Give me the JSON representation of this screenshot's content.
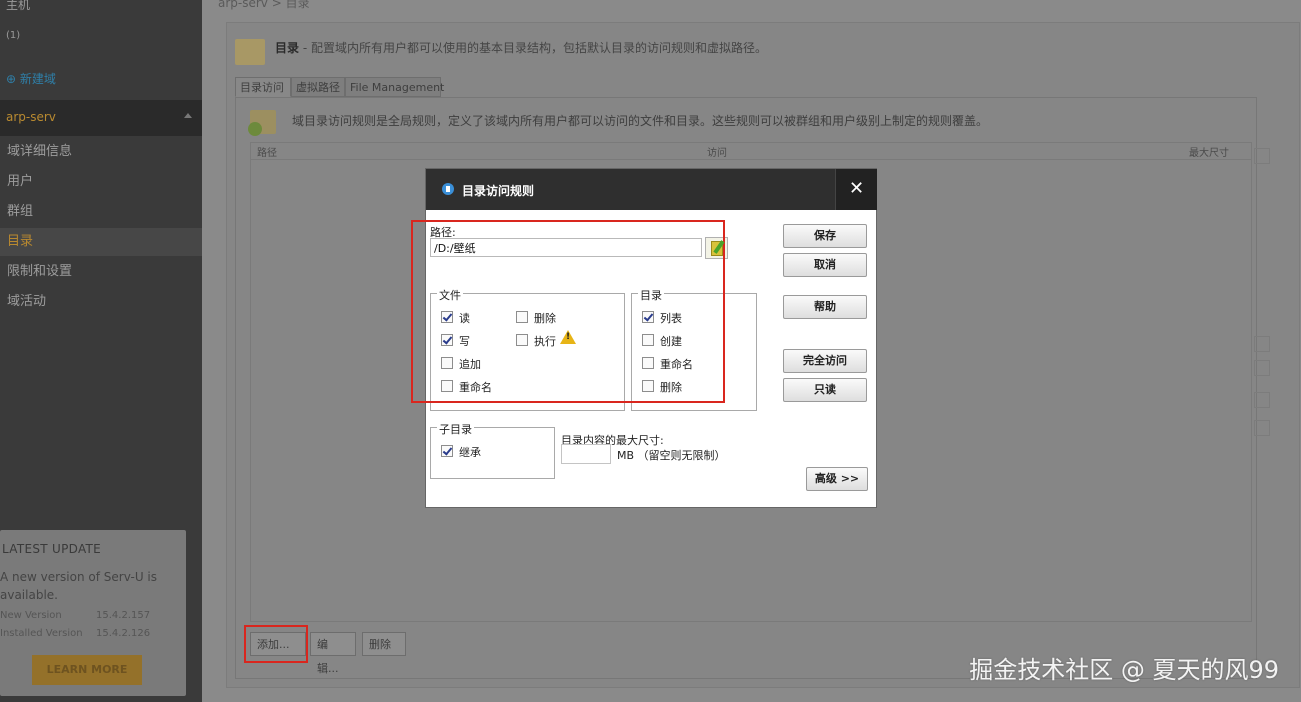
{
  "sidebar": {
    "top_faint_1": "主机",
    "top_faint_2": "(1)",
    "new_domain": "新建域",
    "domain_name": "arp-serv",
    "items": [
      {
        "label": "域详细信息",
        "active": false
      },
      {
        "label": "用户",
        "active": false
      },
      {
        "label": "群组",
        "active": false
      },
      {
        "label": "目录",
        "active": true
      },
      {
        "label": "限制和设置",
        "active": false
      },
      {
        "label": "域活动",
        "active": false
      }
    ]
  },
  "update": {
    "title": "LATEST UPDATE",
    "text": "A new version of Serv-U is available.",
    "new_version_label": "New Version",
    "new_version": "15.4.2.157",
    "installed_version_label": "Installed Version",
    "installed_version": "15.4.2.126",
    "learn_more": "LEARN MORE"
  },
  "main": {
    "breadcrumb": "arp-serv  >  目录",
    "title": "目录",
    "description": " - 配置域内所有用户都可以使用的基本目录结构，包括默认目录的访问规则和虚拟路径。",
    "tabs": [
      "目录访问",
      "虚拟路径",
      "File Management"
    ],
    "rules_description": "域目录访问规则是全局规则，定义了该域内所有用户都可以访问的文件和目录。这些规则可以被群组和用户级别上制定的规则覆盖。",
    "columns": [
      "路径",
      "访问",
      "最大尺寸"
    ],
    "buttons": {
      "add": "添加...",
      "edit": "编辑...",
      "delete": "删除"
    }
  },
  "dialog": {
    "title": "目录访问规则",
    "close": "✕",
    "path_label": "路径:",
    "path_value": "/D:/壁纸",
    "files": {
      "legend": "文件",
      "read": {
        "label": "读",
        "checked": true
      },
      "write": {
        "label": "写",
        "checked": true
      },
      "append": {
        "label": "追加",
        "checked": false
      },
      "rename": {
        "label": "重命名",
        "checked": false
      },
      "delete": {
        "label": "删除",
        "checked": false
      },
      "execute": {
        "label": "执行",
        "checked": false
      }
    },
    "dirs": {
      "legend": "目录",
      "list": {
        "label": "列表",
        "checked": true
      },
      "create": {
        "label": "创建",
        "checked": false
      },
      "rename": {
        "label": "重命名",
        "checked": false
      },
      "remove": {
        "label": "删除",
        "checked": false
      }
    },
    "subdirs": {
      "legend": "子目录",
      "inherit": {
        "label": "继承",
        "checked": true
      }
    },
    "max_size_label": "目录内容的最大尺寸:",
    "max_size_value": "",
    "max_size_unit": "MB （留空则无限制）",
    "buttons": {
      "save": "保存",
      "cancel": "取消",
      "help": "帮助",
      "full_access": "完全访问",
      "read_only": "只读",
      "advanced": "高级 >>"
    }
  },
  "watermark": "掘金技术社区 @ 夏天的风99",
  "colors": {
    "highlight": "#d9261e",
    "sidebar_active": "#b9892f",
    "dialog_title_bg": "#2f2f2f"
  }
}
